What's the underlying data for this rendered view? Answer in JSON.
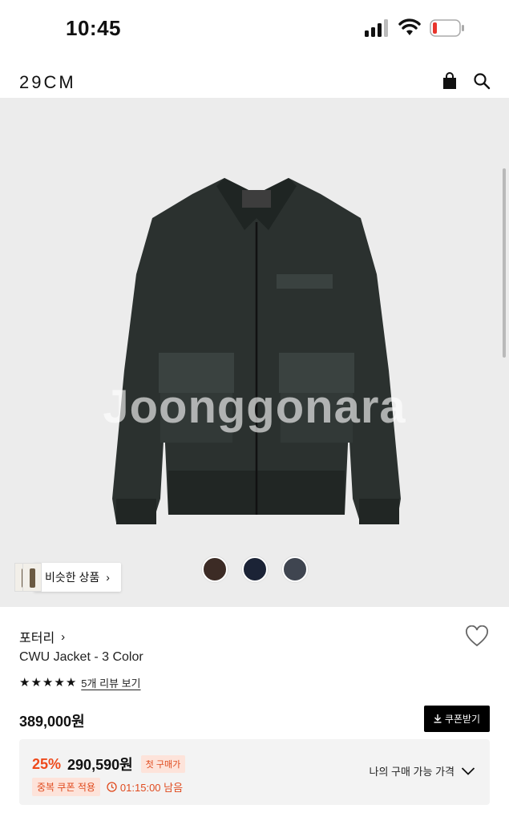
{
  "status_bar": {
    "time": "10:45"
  },
  "header": {
    "logo": "29CM"
  },
  "gallery": {
    "watermark": "Joonggonara",
    "similar_label": "비슷한 상품",
    "swatches": [
      {
        "color": "#3c2b25"
      },
      {
        "color": "#1b2336"
      },
      {
        "color": "#3f4550"
      }
    ]
  },
  "product": {
    "brand": "포터리",
    "name": "CWU Jacket - 3 Color",
    "rating_stars": 5,
    "review_link": "5개 리뷰 보기",
    "price": "389,000원",
    "coupon_button": "쿠폰받기"
  },
  "promo": {
    "discount": "25%",
    "sale_price": "290,590원",
    "first_purchase_tag": "첫 구매가",
    "coupon_tag": "중복 쿠폰 적용",
    "timer": "01:15:00 남음",
    "my_price_label": "나의 구매 가능 가격"
  },
  "colors": {
    "accent": "#ee4a1c",
    "tag_bg": "#fde3da",
    "gallery_bg": "#ececec"
  }
}
